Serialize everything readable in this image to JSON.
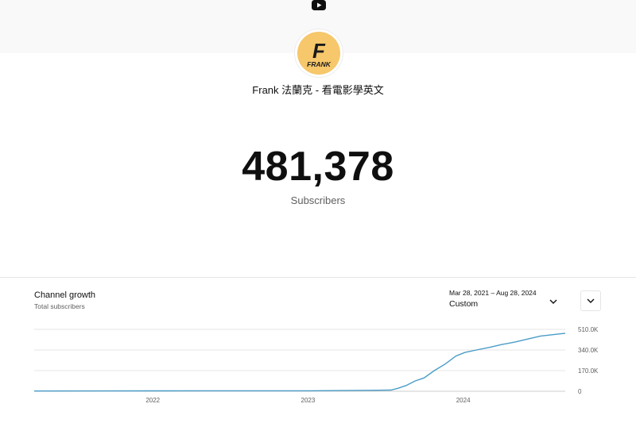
{
  "header": {
    "logo_icon": "youtube-icon",
    "background": "#f9f9f9"
  },
  "channel": {
    "avatar_text": "FRANK",
    "avatar_letter": "F",
    "avatar_color": "#f6c76b",
    "name": "Frank 法蘭克 - 看電影學英文"
  },
  "stats": {
    "subscriber_count": "481,378",
    "subscriber_label": "Subscribers"
  },
  "growth_panel": {
    "title": "Channel growth",
    "subtitle": "Total subscribers",
    "date_range": "Mar 28, 2021 – Aug 28, 2024",
    "range_mode": "Custom",
    "range_icon": "chevron-down-icon",
    "expand_icon": "chevron-down-icon"
  },
  "chart_data": {
    "type": "line",
    "series_color": "#4a9cc7",
    "x_start": "2021-03-28",
    "x_end": "2024-08-28",
    "x_ticks": [
      "2022",
      "2023",
      "2024"
    ],
    "y_ticks": [
      "0",
      "170.0K",
      "340.0K",
      "510.0K"
    ],
    "ylim": [
      0,
      510000
    ],
    "grid": true,
    "legend": "none",
    "points": [
      [
        "2021-03-28",
        2000
      ],
      [
        "2022-01-01",
        3000
      ],
      [
        "2023-01-01",
        4000
      ],
      [
        "2023-04-01",
        6000
      ],
      [
        "2023-06-01",
        8000
      ],
      [
        "2023-07-15",
        10000
      ],
      [
        "2023-08-01",
        25000
      ],
      [
        "2023-08-20",
        48000
      ],
      [
        "2023-09-10",
        85000
      ],
      [
        "2023-10-01",
        110000
      ],
      [
        "2023-10-25",
        170000
      ],
      [
        "2023-11-20",
        225000
      ],
      [
        "2023-12-15",
        290000
      ],
      [
        "2024-01-05",
        320000
      ],
      [
        "2024-02-01",
        340000
      ],
      [
        "2024-03-01",
        360000
      ],
      [
        "2024-04-01",
        385000
      ],
      [
        "2024-05-01",
        405000
      ],
      [
        "2024-06-01",
        430000
      ],
      [
        "2024-07-01",
        455000
      ],
      [
        "2024-08-28",
        478000
      ]
    ]
  }
}
